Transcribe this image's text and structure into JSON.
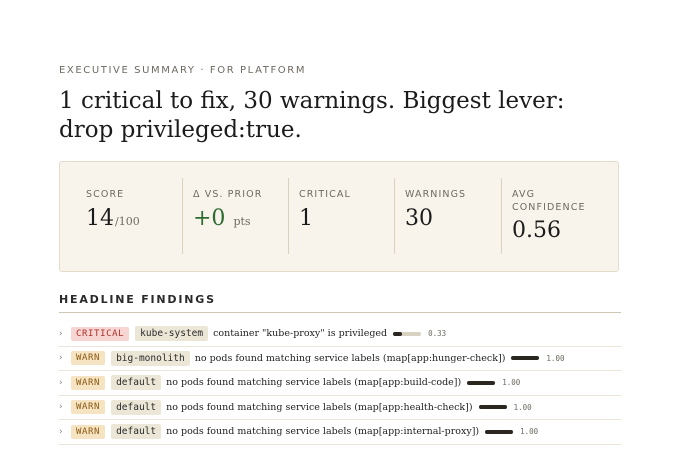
{
  "eyebrow": "EXECUTIVE SUMMARY · FOR PLATFORM",
  "headline": "1 critical to fix, 30 warnings. Biggest lever: drop privileged:true.",
  "stats": {
    "score": {
      "label": "SCORE",
      "value": "14",
      "unit": "/100"
    },
    "delta": {
      "label": "Δ VS. PRIOR",
      "value": "+0",
      "unit": "pts"
    },
    "critical": {
      "label": "CRITICAL",
      "value": "1"
    },
    "warnings": {
      "label": "WARNINGS",
      "value": "30"
    },
    "confidence": {
      "label": "AVG CONFIDENCE",
      "value": "0.56"
    }
  },
  "findings_title": "HEADLINE FINDINGS",
  "findings": [
    {
      "severity": "CRITICAL",
      "namespace": "kube-system",
      "message": "container \"kube-proxy\" is privileged",
      "confidence": 0.33,
      "confidence_label": "0.33"
    },
    {
      "severity": "WARN",
      "namespace": "big-monolith",
      "message": "no pods found matching service labels (map[app:hunger-check])",
      "confidence": 1.0,
      "confidence_label": "1.00"
    },
    {
      "severity": "WARN",
      "namespace": "default",
      "message": "no pods found matching service labels (map[app:build-code])",
      "confidence": 1.0,
      "confidence_label": "1.00"
    },
    {
      "severity": "WARN",
      "namespace": "default",
      "message": "no pods found matching service labels (map[app:health-check])",
      "confidence": 1.0,
      "confidence_label": "1.00"
    },
    {
      "severity": "WARN",
      "namespace": "default",
      "message": "no pods found matching service labels (map[app:internal-proxy])",
      "confidence": 1.0,
      "confidence_label": "1.00"
    }
  ],
  "colors": {
    "critical_badge_bg": "#f6d5d3",
    "warn_badge_bg": "#f6e3c2",
    "delta_green": "#2e6b2e",
    "panel_bg": "#f8f4ec"
  },
  "icons": {
    "row_expand": "chevron-right-icon"
  }
}
